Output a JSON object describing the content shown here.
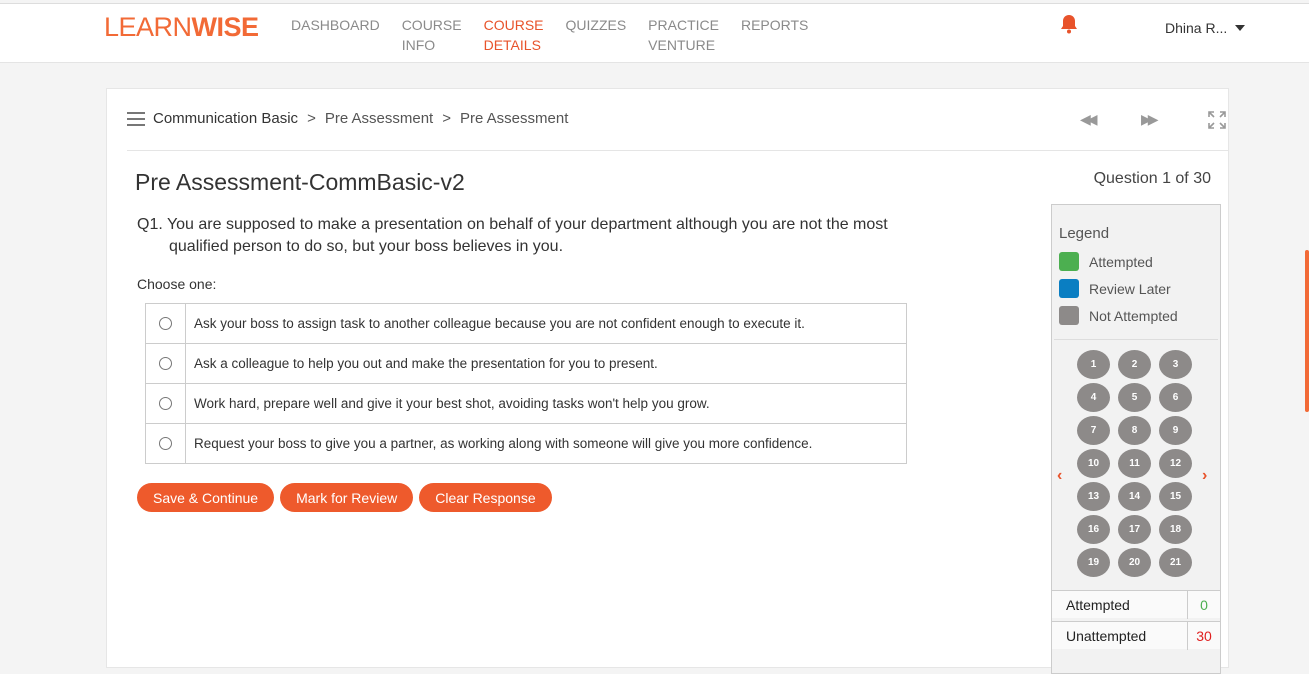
{
  "header": {
    "logo_light": "LEARN",
    "logo_bold": "WISE",
    "nav": [
      {
        "label": "DASHBOARD",
        "active": false
      },
      {
        "label": "COURSE\nINFO",
        "active": false
      },
      {
        "label": "COURSE\nDETAILS",
        "active": true
      },
      {
        "label": "QUIZZES",
        "active": false
      },
      {
        "label": "PRACTICE\nVENTURE",
        "active": false
      },
      {
        "label": "REPORTS",
        "active": false
      }
    ],
    "user": "Dhina R...",
    "accent": "#e8532b"
  },
  "breadcrumb": [
    "Communication Basic",
    "Pre Assessment",
    "Pre Assessment"
  ],
  "breadcrumb_sep": ">",
  "controls": {
    "prev": "◀◀",
    "next": "▶▶"
  },
  "quiz": {
    "title": "Pre Assessment-CommBasic-v2",
    "counter": "Question 1 of 30",
    "question": "Q1. You are supposed to make a presentation on behalf of your department although you are not the most qualified person to do so, but your boss believes in you.",
    "choose": "Choose one:",
    "options": [
      "Ask your boss to assign task to another colleague because you are not confident enough to execute it.",
      "Ask a colleague to help you out and make the presentation for you to present.",
      "Work hard, prepare well and give it your best shot, avoiding tasks won't help you grow.",
      "Request your boss to give you a partner, as working along with someone will give you more confidence."
    ],
    "buttons": {
      "save": "Save & Continue",
      "review": "Mark for Review",
      "clear": "Clear Response"
    }
  },
  "panel": {
    "legend_title": "Legend",
    "legend": [
      {
        "label": "Attempted",
        "color": "#4caf50"
      },
      {
        "label": "Review Later",
        "color": "#0a7ec2"
      },
      {
        "label": "Not Attempted",
        "color": "#8d8a89"
      }
    ],
    "numbers": [
      "1",
      "2",
      "3",
      "4",
      "5",
      "6",
      "7",
      "8",
      "9",
      "10",
      "11",
      "12",
      "13",
      "14",
      "15",
      "16",
      "17",
      "18",
      "19",
      "20",
      "21"
    ],
    "stats": [
      {
        "label": "Attempted",
        "value": "0",
        "color": "#4caf50"
      },
      {
        "label": "Unattempted",
        "value": "30",
        "color": "#e02020"
      }
    ]
  }
}
